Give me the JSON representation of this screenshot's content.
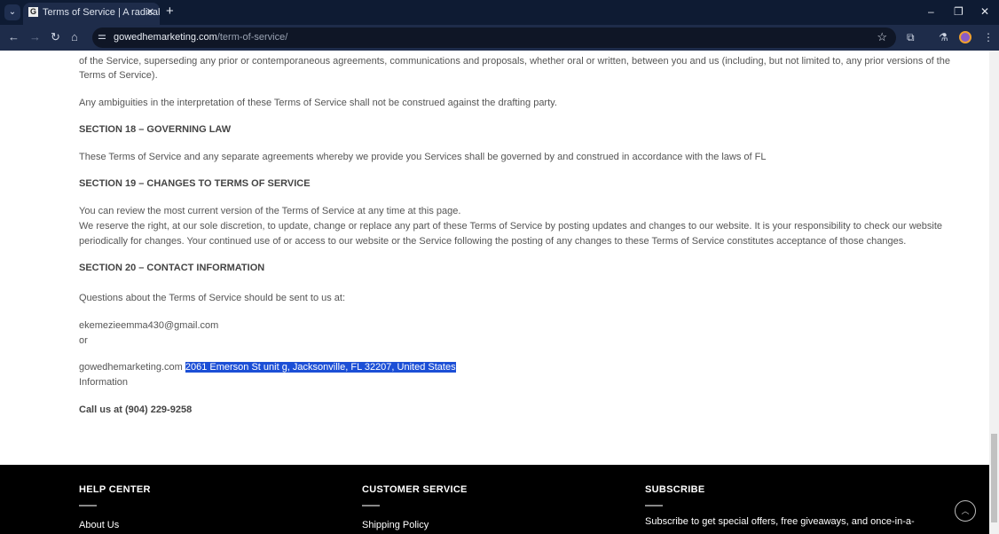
{
  "browser": {
    "tab_title": "Terms of Service | A radical new",
    "url_domain": "gowedhemarketing.com",
    "url_path": "/term-of-service/"
  },
  "content": {
    "line1": "of the Service, superseding any prior or contemporaneous agreements, communications and proposals, whether oral or written, between you and us (including, but not limited to, any prior versions of the",
    "line2": "Terms of Service).",
    "ambiguities": "Any ambiguities in the interpretation of these Terms of Service shall not be construed against the drafting party.",
    "s18": "SECTION 18 – GOVERNING LAW",
    "s18_text": "These Terms of Service and any separate agreements whereby we provide you Services shall be governed by and construed in accordance with the laws of FL",
    "s19": "SECTION 19 – CHANGES TO TERMS OF SERVICE",
    "s19_a": "You can review the most current version of the Terms of Service at any time at this page.",
    "s19_b": "We reserve the right, at our sole discretion, to update, change or replace any part of these Terms of Service by posting updates and changes to our website. It is your responsibility to check our website",
    "s19_c": "periodically for changes. Your continued use of or access to our website or the Service following the posting of any changes to these Terms of Service constitutes acceptance of those changes.",
    "s20": "SECTION 20 – CONTACT INFORMATION",
    "questions": "Questions about the Terms of Service should be sent to us at:",
    "email": "ekemezieemma430@gmail.com",
    "or": "or",
    "site": "gowedhemarketing.com",
    "address": "2061 Emerson St unit g, Jacksonville, FL 32207, United States",
    "information": "Information",
    "call": "Call us at (904) 229-9258"
  },
  "footer": {
    "help": "HELP CENTER",
    "help_item": "About Us",
    "customer": "CUSTOMER SERVICE",
    "customer_item": "Shipping Policy",
    "subscribe": "SUBSCRIBE",
    "subscribe_text": "Subscribe to get special offers, free giveaways, and once-in-a-"
  }
}
